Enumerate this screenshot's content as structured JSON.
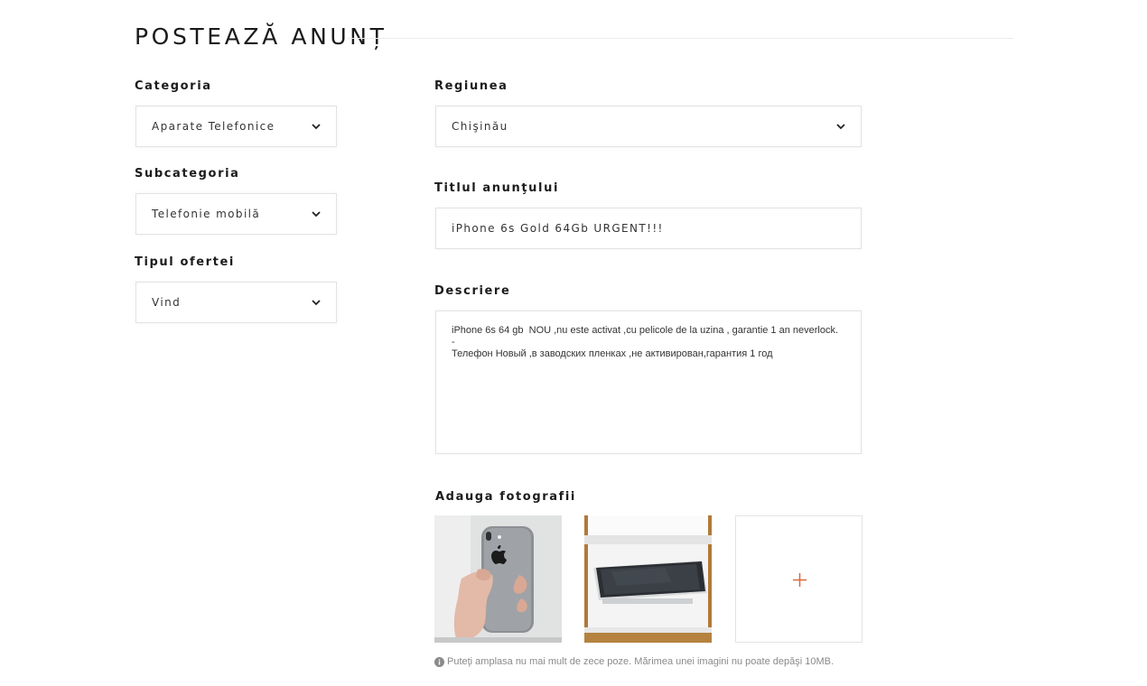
{
  "page": {
    "title": "POSTEAZĂ ANUNȚ"
  },
  "form": {
    "category": {
      "label": "Categoria",
      "value": "Aparate Telefonice"
    },
    "subcategory": {
      "label": "Subcategoria",
      "value": "Telefonie mobilă"
    },
    "offer_type": {
      "label": "Tipul ofertei",
      "value": "Vind"
    },
    "region": {
      "label": "Regiunea",
      "value": "Chişinău"
    },
    "ad_title": {
      "label": "Titlul anunţului",
      "value": "iPhone 6s Gold 64Gb URGENT!!!"
    },
    "description": {
      "label": "Descriere",
      "value": "iPhone 6s 64 gb  NOU ,nu este activat ,cu pelicole de la uzina , garantie 1 an neverlock.\n-\nТелефон Новый ,в заводских пленках ,не активирован,гарантия 1 год"
    },
    "photos": {
      "label": "Adauga fotografii",
      "items": [
        {
          "icon": "apple-logo-icon"
        },
        {
          "icon": "phone-in-box"
        }
      ],
      "add_icon": "plus-icon",
      "note": "Puteţi amplasa nu mai mult de zece poze. Mărimea unei imagini nu poate depăşi 10MB."
    }
  },
  "colors": {
    "accent": "#e0673a",
    "border": "#e3e3e3",
    "muted": "#8a8a8a"
  },
  "icons": {
    "select_arrow": "chevron-down-icon",
    "note": "info-icon"
  }
}
